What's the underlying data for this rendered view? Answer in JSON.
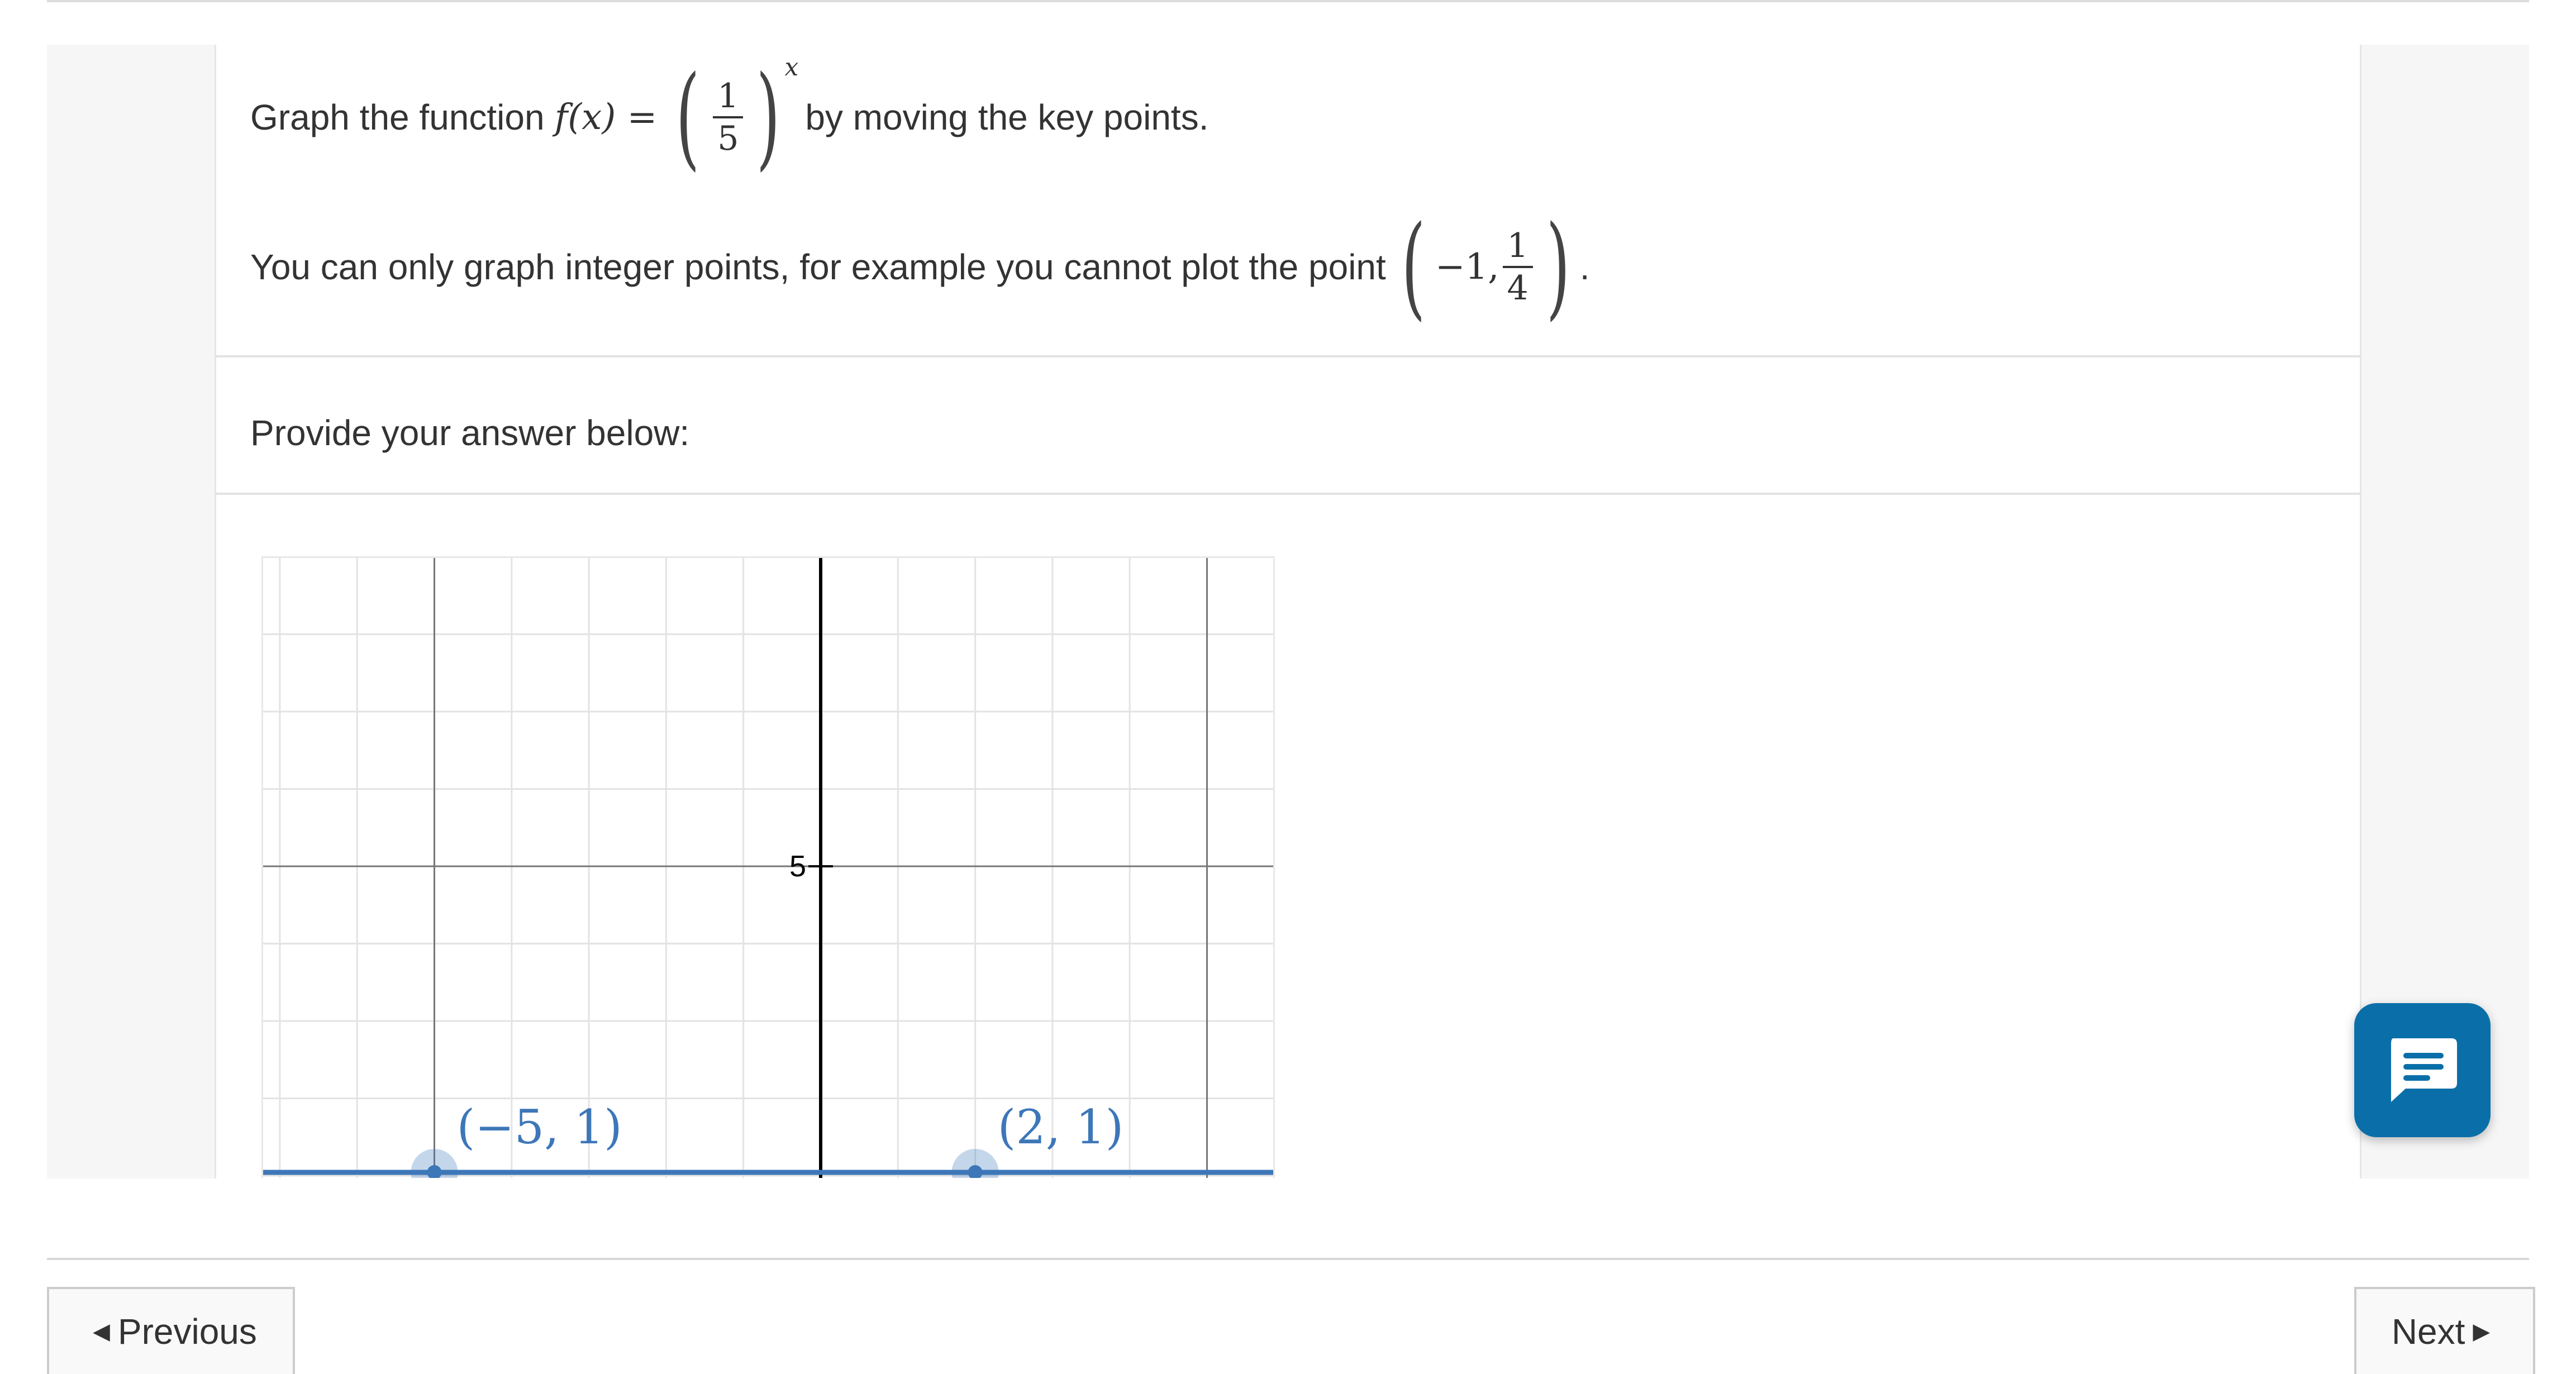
{
  "question": {
    "line1_prefix": "Graph the function",
    "function_lhs": "f(x) =",
    "base_numerator": "1",
    "base_denominator": "5",
    "exponent": "x",
    "line1_suffix": "by moving the key points.",
    "line2_prefix": "You can only graph integer points, for example you cannot plot the point",
    "example_x": "−1,",
    "example_numerator": "1",
    "example_denominator": "4",
    "line2_suffix": "."
  },
  "answer_prompt": "Provide your answer below:",
  "graph": {
    "axis_tick_label": "5",
    "points": [
      {
        "label": "(−5, 1)",
        "x": -5,
        "y": 1
      },
      {
        "label": "(2, 1)",
        "x": 2,
        "y": 1
      }
    ],
    "line_color": "#3d77b8",
    "point_color": "#3d77b8",
    "label_color": "#3d77b8"
  },
  "chat": {
    "icon": "chat-icon"
  },
  "nav": {
    "previous_label": "Previous",
    "next_label": "Next",
    "previous_icon": "caret-left-icon",
    "next_icon": "caret-right-icon"
  },
  "colors": {
    "accent": "#0a6fa8"
  }
}
